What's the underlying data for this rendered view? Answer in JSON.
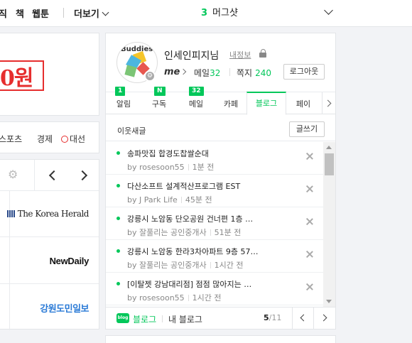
{
  "topbar": {
    "menu_items": [
      "직",
      "책",
      "웹툰"
    ],
    "more_label": "더보기",
    "keyword_rank": "3",
    "keyword_text": "머그샷"
  },
  "ad": {
    "price_text": "0원"
  },
  "news_nav": {
    "tabs": [
      "스포츠",
      "경제",
      "대선"
    ]
  },
  "press": {
    "logos": [
      "The Korea Herald",
      "NewDaily",
      "강원도민일보"
    ]
  },
  "profile": {
    "username": "인세인피지님",
    "my_info": "내정보",
    "me_label": "me",
    "mail_label": "메일",
    "mail_count": "32",
    "note_label": "쪽지",
    "note_count": "240",
    "logout_label": "로그아웃",
    "avatar_text": "Buddies"
  },
  "tabs": [
    {
      "label": "알림",
      "badge": "1"
    },
    {
      "label": "구독",
      "badge": "N"
    },
    {
      "label": "메일",
      "badge": "32"
    },
    {
      "label": "카페",
      "badge": ""
    },
    {
      "label": "블로그",
      "badge": ""
    },
    {
      "label": "페이",
      "badge": ""
    }
  ],
  "feed": {
    "title": "이웃새글",
    "write_label": "글쓰기",
    "items": [
      {
        "title": "송파맛집 합경도찹쌀순대",
        "author": "by rosesoon55",
        "time": "1분 전"
      },
      {
        "title": "다산소프트 설계적산프로그램 EST",
        "author": "by J Park Life",
        "time": "45분 전"
      },
      {
        "title": "강릉시 노암동 단오공원 건너편 1층 …",
        "author": "by 잘풀리는 공인중개사",
        "time": "51분 전"
      },
      {
        "title": "강릉시 노암동 한라3차아파트 9층 57…",
        "author": "by 잘풀리는 공인중개사",
        "time": "1시간 전"
      },
      {
        "title": "[이탈젯 강남대리점] 점점 많아지는 …",
        "author": "by rosesoon55",
        "time": "1시간 전"
      }
    ]
  },
  "footer": {
    "blog_icon_text": "blog",
    "blog_label": "블로그",
    "my_blog_label": "내 블로그",
    "page_current": "5",
    "page_total": "/11"
  }
}
